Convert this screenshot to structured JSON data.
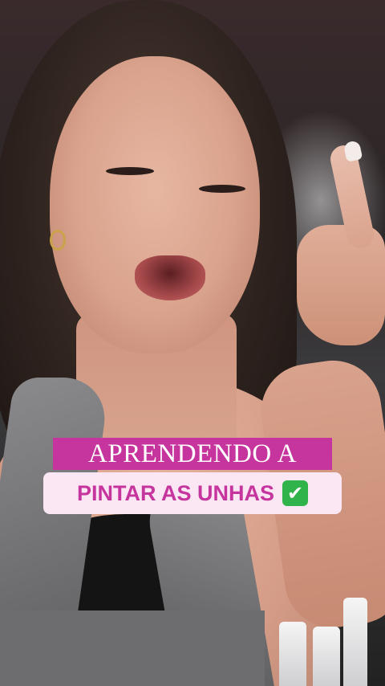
{
  "overlay": {
    "line1": "APRENDENDO A",
    "line2": "PINTAR AS UNHAS",
    "emoji": "✔",
    "emoji_icon": "check-mark-button-icon"
  },
  "colors": {
    "caption_banner": "#c6359e",
    "caption_box": "#fbe7f3",
    "caption_text_pink": "#c6359e",
    "check_green": "#2fb34a"
  }
}
